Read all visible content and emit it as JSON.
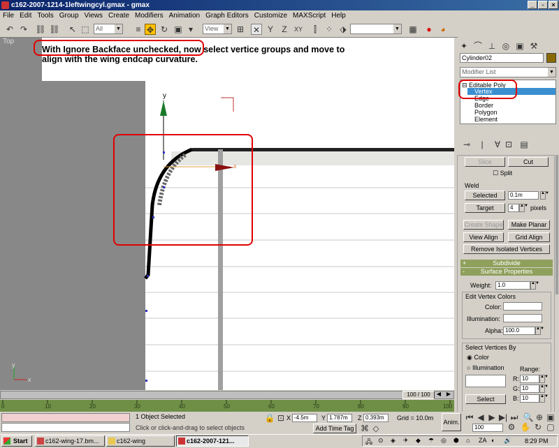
{
  "window": {
    "title": "c162-2007-1214-1leftwingcyl.gmax - gmax"
  },
  "menu": [
    "File",
    "Edit",
    "Tools",
    "Group",
    "Views",
    "Create",
    "Modifiers",
    "Animation",
    "Graph Editors",
    "Customize",
    "MAXScript",
    "Help"
  ],
  "toolbar": {
    "selection_filter": "All",
    "ref_coord": "View",
    "named_selection": ""
  },
  "viewport": {
    "label": "Top",
    "axis_y": "y",
    "axis_x": "x",
    "annotation_line1": "With Ignore Backface unchecked, now select vertice groups and move to",
    "annotation_line2": "align with the wing endcap curvature."
  },
  "command_panel": {
    "object_name": "Cylinder02",
    "modifier_list": "Modifier List",
    "stack": {
      "base": "Editable Poly",
      "items": [
        "Vertex",
        "Edge",
        "Border",
        "Polygon",
        "Element"
      ],
      "selected": "Vertex"
    },
    "edit_geometry": {
      "slice": "Slice",
      "cut": "Cut",
      "split": "Split"
    },
    "weld": {
      "title": "Weld",
      "selected_label": "Selected",
      "selected_value": "0.1m",
      "target_label": "Target",
      "target_value": "4",
      "pixels": "pixels"
    },
    "buttons": {
      "create_shape": "Create Shape",
      "make_planar": "Make Planar",
      "view_align": "View Align",
      "grid_align": "Grid Align",
      "remove_isolated": "Remove Isolated Vertices"
    },
    "rollouts": {
      "subdivide": "Subdivide",
      "surface_properties": "Surface Properties"
    },
    "surface": {
      "weight_label": "Weight:",
      "weight_value": "1.0",
      "edit_vertex_colors": "Edit Vertex Colors",
      "color_label": "Color:",
      "illumination_label": "Illumination:",
      "alpha_label": "Alpha:",
      "alpha_value": "100.0",
      "select_vertices_by": "Select Vertices By",
      "radio_color": "Color",
      "radio_illumination": "Illumination",
      "range_label": "Range:",
      "r_label": "R:",
      "g_label": "G:",
      "b_label": "B:",
      "r_value": "10",
      "g_value": "10",
      "b_value": "10",
      "select_btn": "Select"
    }
  },
  "timeline": {
    "frame": "100 / 100",
    "ticks": [
      "0",
      "10",
      "20",
      "30",
      "40",
      "50",
      "60",
      "70",
      "80",
      "90",
      "100"
    ]
  },
  "status": {
    "objects": "1 Object Selected",
    "prompt": "Click or click-and-drag to select objects",
    "x_label": "X",
    "x_value": "-4.5m",
    "y_label": "Y",
    "y_value": "1.787m",
    "z_label": "Z",
    "z_value": "0.393m",
    "grid": "Grid = 10.0m",
    "add_time_tag": "Add Time Tag",
    "anim": "Anim.",
    "frame_value": "100"
  },
  "taskbar": {
    "start": "Start",
    "tasks": [
      "c162-wing-17.bm...",
      "c162-wing",
      "c162-2007-121..."
    ],
    "clock": "8:29 PM"
  }
}
